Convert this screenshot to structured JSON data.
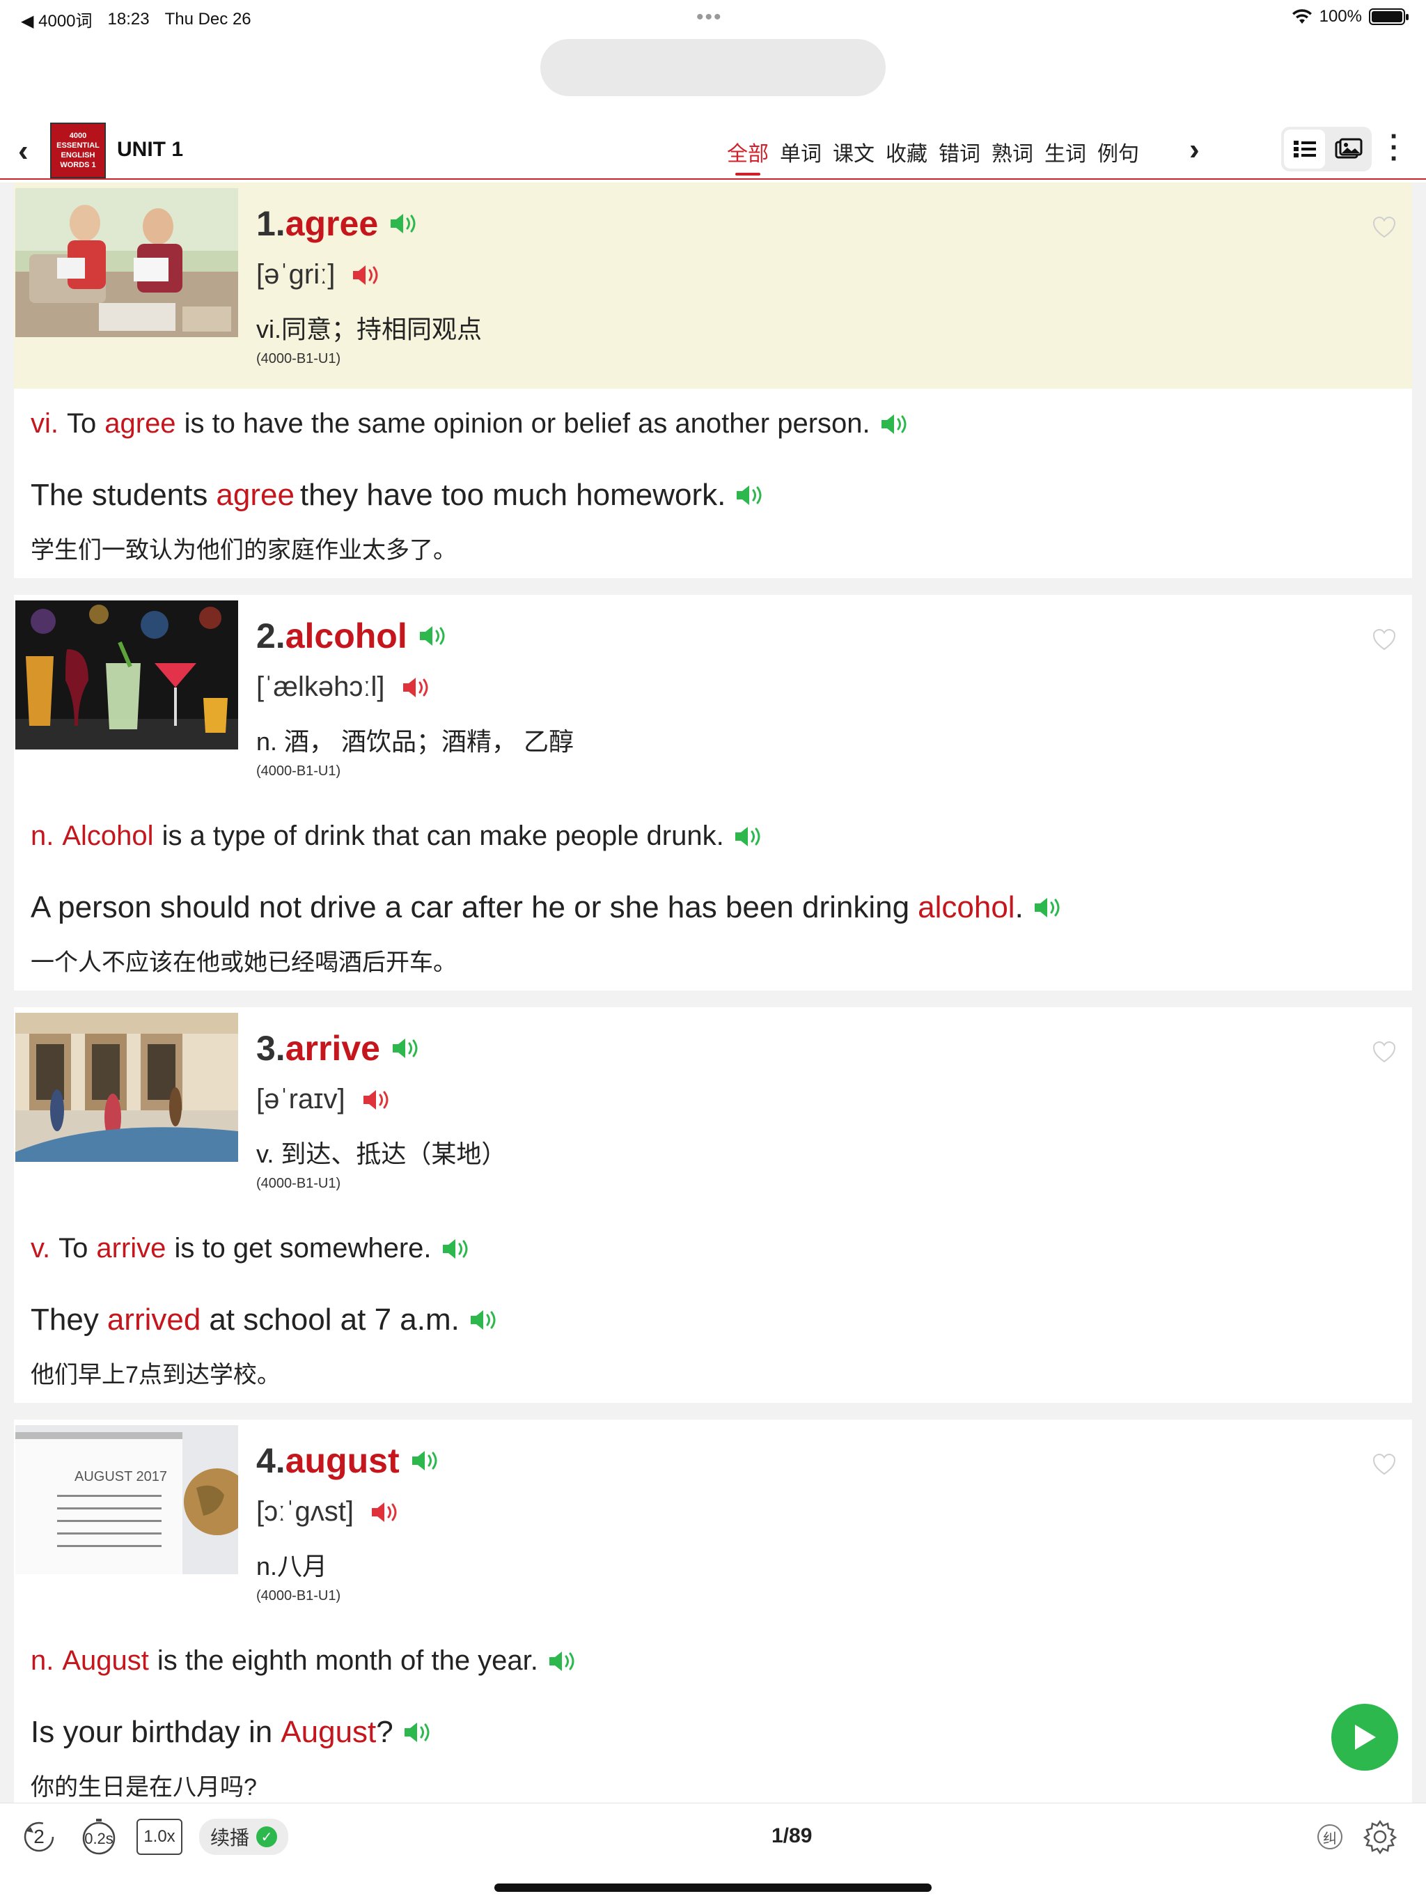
{
  "status_bar": {
    "back_app": "◀ 4000词",
    "time": "18:23",
    "date": "Thu Dec 26",
    "battery": "100%"
  },
  "nav": {
    "book_cover_text": "4000 ESSENTIAL ENGLISH WORDS 1",
    "unit_title": "UNIT 1",
    "tabs": [
      "全部",
      "单词",
      "课文",
      "收藏",
      "错词",
      "熟词",
      "生词",
      "例句"
    ],
    "active_tab": "全部"
  },
  "colors": {
    "accent": "#c4161c",
    "speaker_green": "#2db84d",
    "speaker_red": "#e0323a",
    "highlight_bg": "#f6f4dd"
  },
  "words": [
    {
      "num": "1.",
      "word": "agree",
      "phonetic": "[əˈgriː]",
      "meaning": "vi.同意；持相同观点",
      "code": "(4000-B1-U1)",
      "def_pos": "vi.",
      "def_before": "To",
      "def_word": "agree",
      "def_after": "is to have the same opinion or belief as another person.",
      "ex_before": "The students",
      "ex_word": "agree",
      "ex_after": "they have too much homework.",
      "cn": "学生们一致认为他们的家庭作业太多了。",
      "image": "students-studying-photo"
    },
    {
      "num": "2.",
      "word": "alcohol",
      "phonetic": "[ˈælkəhɔːl]",
      "meaning": "n. 酒， 酒饮品；酒精， 乙醇",
      "code": "(4000-B1-U1)",
      "def_pos": "n.",
      "def_before": "",
      "def_word": "Alcohol",
      "def_after": "is a type of drink that can make people drunk.",
      "ex_before": "A person should not drive a car after he or she has been drinking",
      "ex_word": "alcohol",
      "ex_after": ".",
      "cn": "一个人不应该在他或她已经喝酒后开车。",
      "image": "cocktail-glasses-photo"
    },
    {
      "num": "3.",
      "word": "arrive",
      "phonetic": "[əˈraɪv]",
      "meaning": "v. 到达、抵达（某地）",
      "code": "(4000-B1-U1)",
      "def_pos": "v.",
      "def_before": "To",
      "def_word": "arrive",
      "def_after": "is to get somewhere.",
      "ex_before": "They",
      "ex_word": "arrived",
      "ex_after": "at school at 7 a.m.",
      "cn": "他们早上7点到达学校。",
      "image": "students-arriving-photo"
    },
    {
      "num": "4.",
      "word": "august",
      "phonetic": "[ɔːˈgʌst]",
      "meaning": "n.八月",
      "code": "(4000-B1-U1)",
      "def_pos": "n.",
      "def_before": "",
      "def_word": "August",
      "def_after": "is the eighth month of the year.",
      "ex_before": "Is your birthday in",
      "ex_word": "August",
      "ex_after": "?",
      "cn": "你的生日是在八月吗?",
      "image": "calendar-globe-photo",
      "calendar_label": "AUGUST 2017"
    }
  ],
  "toolbar": {
    "repeat_count": "2",
    "interval": "0.2s",
    "speed": "1.0x",
    "continuous_label": "续播",
    "page_indicator": "1/89",
    "correct_label": "纠"
  }
}
